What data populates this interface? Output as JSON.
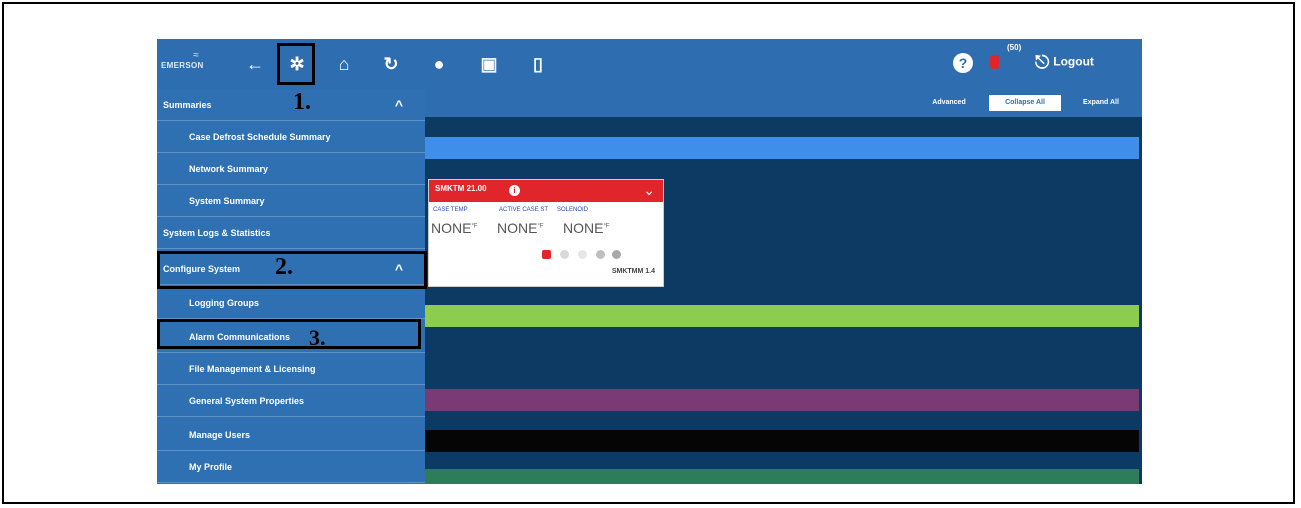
{
  "topbar": {
    "logo_text": "EMERSON",
    "icons": [
      "back-icon",
      "settings-icon",
      "home-icon",
      "refresh-icon",
      "globe-icon",
      "calendar-icon",
      "map-icon"
    ],
    "help": "?",
    "alarm_count": "(50)",
    "logout_label": "Logout"
  },
  "sidebar": {
    "items": [
      {
        "label": "Summaries",
        "chevron": "^"
      },
      {
        "label": "Case Defrost Schedule Summary"
      },
      {
        "label": "Network Summary"
      },
      {
        "label": "System Summary"
      },
      {
        "label": "System Logs & Statistics"
      },
      {
        "label": "Configure System",
        "chevron": "^"
      },
      {
        "label": "Logging Groups"
      },
      {
        "label": "Alarm Communications"
      },
      {
        "label": "File Management & Licensing"
      },
      {
        "label": "General System Properties"
      },
      {
        "label": "Manage Users"
      },
      {
        "label": "My Profile"
      }
    ]
  },
  "annotations": {
    "one": "1.",
    "two": "2.",
    "three": "3."
  },
  "main": {
    "buttons": {
      "advanced": "Advanced",
      "collapse": "Collapse All",
      "expand": "Expand All"
    }
  },
  "card": {
    "title": "SMKTM 21.00",
    "col1_label": "CASE TEMP",
    "col2_label": "ACTIVE CASE ST",
    "col3_label": "SOLENOID",
    "col1_value": "NONE",
    "col2_value": "NONE",
    "col3_value": "NONE",
    "unit": "°F",
    "id": "SMKTMM 1.4"
  },
  "colors": {
    "topbar": "#2d6db0",
    "sidebar": "#2f70b3",
    "background": "#0d3a63",
    "alarm": "#e0262b",
    "strip_blue": "#3f8fea",
    "strip_green": "#8ccc4f",
    "strip_purple": "#7a3b74",
    "strip_black": "#050505",
    "strip_teal": "#2e7d5a"
  }
}
